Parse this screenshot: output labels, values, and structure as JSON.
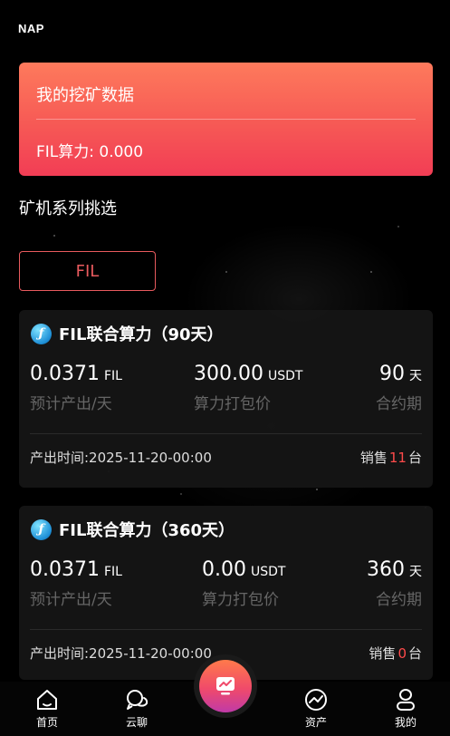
{
  "header": {
    "brand": "NAP"
  },
  "mining": {
    "title": "我的挖矿数据",
    "hashrate": "FIL算力: 0.000"
  },
  "series": {
    "heading": "矿机系列挑选",
    "filter": "FIL"
  },
  "products": [
    {
      "title": "FIL联合算力（90天）",
      "output": {
        "value": "0.0371",
        "unit": "FIL",
        "label": "预计产出/天"
      },
      "price": {
        "value": "300.00",
        "unit": "USDT",
        "label": "算力打包价"
      },
      "term": {
        "value": "90",
        "unit": "天",
        "label": "合约期"
      },
      "output_time": "产出时间:2025-11-20-00:00",
      "sold": {
        "prefix": "销售",
        "count": "11",
        "suffix": "台"
      }
    },
    {
      "title": "FIL联合算力（360天）",
      "output": {
        "value": "0.0371",
        "unit": "FIL",
        "label": "预计产出/天"
      },
      "price": {
        "value": "0.00",
        "unit": "USDT",
        "label": "算力打包价"
      },
      "term": {
        "value": "360",
        "unit": "天",
        "label": "合约期"
      },
      "output_time": "产出时间:2025-11-20-00:00",
      "sold": {
        "prefix": "销售",
        "count": "0",
        "suffix": "台"
      }
    }
  ],
  "tabbar": {
    "home": "首页",
    "chat": "云聊",
    "assets": "资产",
    "mine": "我的"
  },
  "colors": {
    "accent": "#f65955",
    "sold_count": "#ff4a4a",
    "filter": "#e85a5e"
  },
  "icons": {
    "coin": "filecoin-icon",
    "home": "home-icon",
    "chat": "chat-bubbles-icon",
    "center": "chart-screen-icon",
    "assets": "trend-icon",
    "mine": "user-icon"
  }
}
